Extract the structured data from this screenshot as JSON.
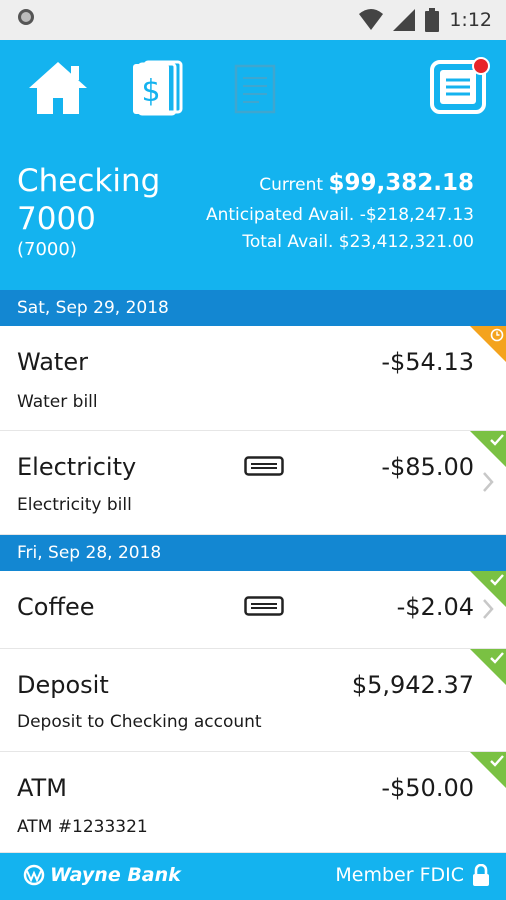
{
  "status_bar": {
    "time": "1:12"
  },
  "nav": {
    "items": [
      {
        "name": "home",
        "icon": "home-icon"
      },
      {
        "name": "accounts",
        "icon": "dollar-cards-icon"
      },
      {
        "name": "documents",
        "icon": "document-icon"
      },
      {
        "name": "menu",
        "icon": "menu-icon",
        "has_notification": true
      }
    ]
  },
  "account": {
    "name": "Checking 7000",
    "number": "(7000)",
    "current_label": "Current",
    "current_value": "$99,382.18",
    "anticipated": "Anticipated Avail. -$218,247.13",
    "total": "Total Avail. $23,412,321.00"
  },
  "groups": [
    {
      "date": "Sat, Sep 29, 2018",
      "transactions": [
        {
          "name": "Water",
          "description": "Water bill",
          "amount": "-$54.13",
          "status": "pending"
        },
        {
          "name": "Electricity",
          "description": "Electricity bill",
          "amount": "-$85.00",
          "status": "cleared"
        }
      ]
    },
    {
      "date": "Fri, Sep 28, 2018",
      "transactions": [
        {
          "name": "Coffee",
          "description": "",
          "amount": "-$2.04",
          "status": "cleared"
        },
        {
          "name": "Deposit",
          "description": "Deposit to Checking account",
          "amount": "$5,942.37",
          "status": "cleared"
        },
        {
          "name": "ATM",
          "description": "ATM #1233321",
          "amount": "-$50.00",
          "status": "cleared"
        }
      ]
    }
  ],
  "footer": {
    "brand": "Wayne Bank",
    "fdic": "Member FDIC"
  },
  "colors": {
    "header": "#14b3ef",
    "date_header": "#1387d2",
    "cleared": "#7ac143",
    "pending": "#f4a31d"
  }
}
